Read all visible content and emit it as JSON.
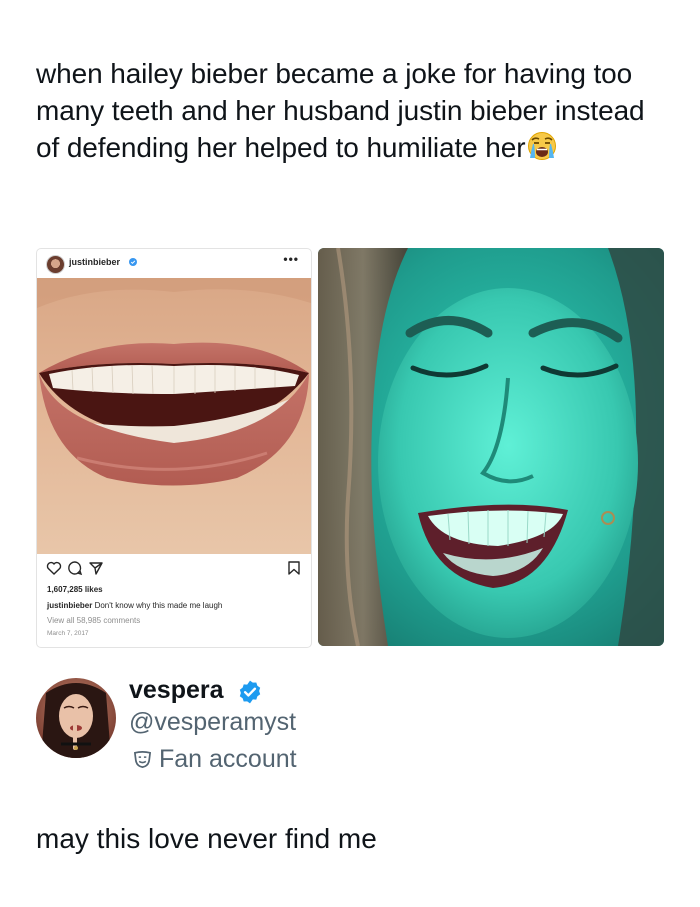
{
  "post": {
    "text": "when hailey bieber became a joke for having too many teeth and her husband justin bieber instead of defending her helped to humiliate her",
    "emoji": "loudly-crying-face-emoji"
  },
  "instagram": {
    "username": "justinbieber",
    "verified_icon": "verified-badge-icon",
    "more_icon": "•••",
    "icons": [
      "heart-icon",
      "comment-icon",
      "share-icon",
      "bookmark-icon"
    ],
    "likes": "1,607,285 likes",
    "caption_user": "justinbieber",
    "caption_text": " Don't know why this made me laugh",
    "comments": "View all 58,985 comments",
    "date": "March 7, 2017"
  },
  "profile": {
    "display_name": "vespera",
    "handle": "@vesperamyst",
    "label": "Fan account",
    "verified_color": "#1d9bf0"
  },
  "reply": {
    "text": "may this love never find me"
  },
  "colors": {
    "text": "#0f1419",
    "secondary": "#536471",
    "ig_text": "#262626",
    "ig_muted": "#8e8e8e"
  }
}
